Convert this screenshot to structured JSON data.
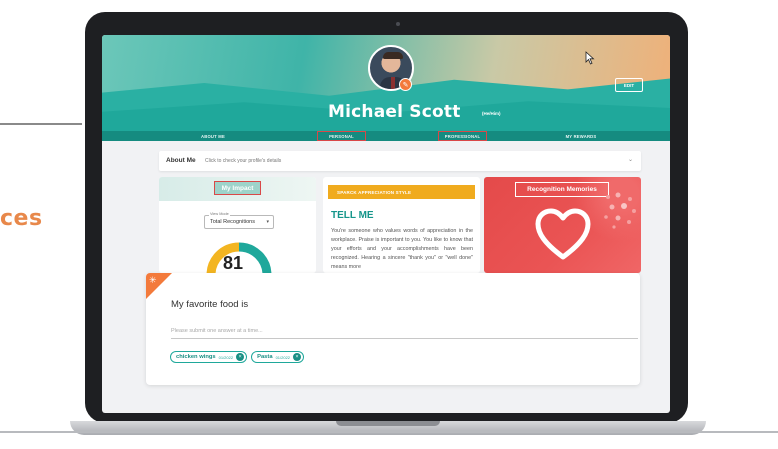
{
  "left_slide": {
    "partial_heading": "ces"
  },
  "header": {
    "name": "Michael Scott",
    "pronouns": "(He/Him)",
    "edit_label": "EDIT"
  },
  "tabs": [
    {
      "label": "ABOUT ME"
    },
    {
      "label": "PERSONAL"
    },
    {
      "label": "PROFESSIONAL"
    },
    {
      "label": "MY REWARDS"
    }
  ],
  "about": {
    "title": "About Me",
    "subtitle": "Click to check your profile's details"
  },
  "impact": {
    "title": "My Impact",
    "select_label": "View Mode",
    "select_value": "Total Recognitions",
    "value": "81"
  },
  "style": {
    "header": "SPARCK APPRECIATION STYLE",
    "title": "TELL ME",
    "body": "You're someone who values words of appreciation in the workplace. Praise is important to you. You like to know that your efforts and your accomplishments have been recognized. Hearing a sincere \"thank you\" or \"well done\" means more"
  },
  "memories": {
    "title": "Recognition Memories"
  },
  "food": {
    "question": "My favorite food is",
    "placeholder": "Please submit one answer at a time...",
    "answers": [
      {
        "label": "chicken wings",
        "date": "01/2022"
      },
      {
        "label": "Pasta",
        "date": "01/2022"
      }
    ]
  },
  "colors": {
    "teal": "#1fa89b",
    "nav": "#158b80",
    "orange": "#f37a3b",
    "amber": "#f0ab1e",
    "red": "#e44a4a",
    "highlight_box": "#d94848"
  },
  "icons": {
    "avatar_edit": "pencil-icon",
    "about_toggle": "chevron-down-icon",
    "corner": "sparkle-icon",
    "chip_remove": "close-icon",
    "memories": "heart-icon"
  }
}
